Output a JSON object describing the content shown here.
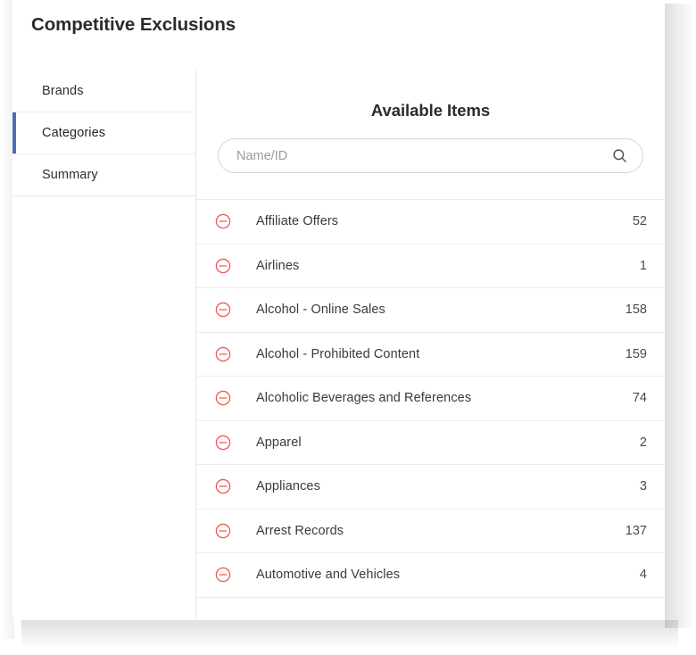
{
  "page": {
    "title": "Competitive Exclusions"
  },
  "sidebar": {
    "items": [
      {
        "label": "Brands",
        "active": false
      },
      {
        "label": "Categories",
        "active": true
      },
      {
        "label": "Summary",
        "active": false
      }
    ]
  },
  "main": {
    "panel_title": "Available Items",
    "search": {
      "placeholder": "Name/ID",
      "value": "",
      "icon": "search-icon"
    },
    "row_icon": "minus-circle-icon",
    "items": [
      {
        "label": "Affiliate Offers",
        "count": "52"
      },
      {
        "label": "Airlines",
        "count": "1"
      },
      {
        "label": "Alcohol - Online Sales",
        "count": "158"
      },
      {
        "label": "Alcohol - Prohibited Content",
        "count": "159"
      },
      {
        "label": "Alcoholic Beverages and References",
        "count": "74"
      },
      {
        "label": "Apparel",
        "count": "2"
      },
      {
        "label": "Appliances",
        "count": "3"
      },
      {
        "label": "Arrest Records",
        "count": "137"
      },
      {
        "label": "Automotive and Vehicles",
        "count": "4"
      }
    ]
  },
  "colors": {
    "accent_active": "#4a6fb5",
    "remove_icon": "#f2574f",
    "text_primary": "#2b2b2b",
    "divider": "#ececec"
  }
}
